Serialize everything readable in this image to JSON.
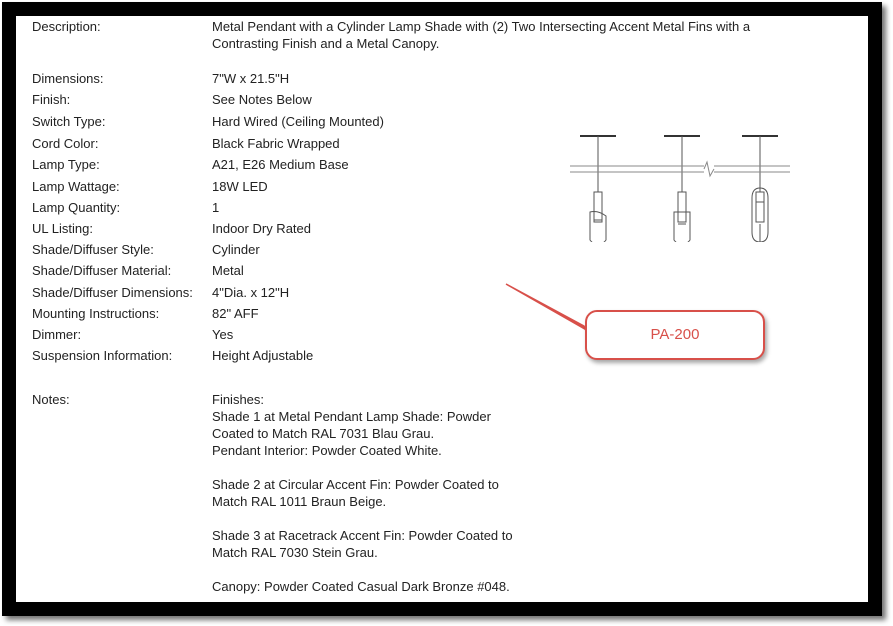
{
  "specs": [
    {
      "label": "Description:",
      "value": "Metal Pendant with a Cylinder Lamp Shade with (2) Two Intersecting Accent Metal Fins with a Contrasting Finish and a Metal Canopy."
    },
    {
      "label": "Dimensions:",
      "value": "7\"W x 21.5\"H"
    },
    {
      "label": "Finish:",
      "value": "See Notes Below"
    },
    {
      "label": "Switch Type:",
      "value": "Hard Wired (Ceiling Mounted)"
    },
    {
      "label": "Cord Color:",
      "value": "Black Fabric Wrapped"
    },
    {
      "label": "Lamp Type:",
      "value": "A21, E26 Medium Base"
    },
    {
      "label": "Lamp Wattage:",
      "value": "18W LED"
    },
    {
      "label": "Lamp Quantity:",
      "value": "1"
    },
    {
      "label": "UL Listing:",
      "value": "Indoor Dry Rated"
    },
    {
      "label": "Shade/Diffuser Style:",
      "value": "Cylinder"
    },
    {
      "label": "Shade/Diffuser Material:",
      "value": "Metal"
    },
    {
      "label": "Shade/Diffuser Dimensions:",
      "value": "4\"Dia. x 12\"H"
    },
    {
      "label": "Mounting Instructions:",
      "value": "82\" AFF"
    },
    {
      "label": "Dimmer:",
      "value": "Yes"
    },
    {
      "label": "Suspension Information:",
      "value": "Height Adjustable"
    }
  ],
  "notes": {
    "label": "Notes:",
    "paragraphs": [
      "Finishes:\nShade 1 at Metal Pendant Lamp Shade: Powder\nCoated to Match RAL 7031 Blau Grau.\nPendant Interior: Powder Coated White.",
      "Shade 2 at Circular Accent Fin: Powder Coated to\nMatch RAL 1011 Braun Beige.",
      "Shade 3 at Racetrack Accent Fin: Powder Coated to\nMatch RAL 7030 Stein Grau.",
      "Canopy: Powder Coated Casual Dark Bronze #048."
    ]
  },
  "callout": {
    "label": "PA-200",
    "color": "#d8504a"
  }
}
